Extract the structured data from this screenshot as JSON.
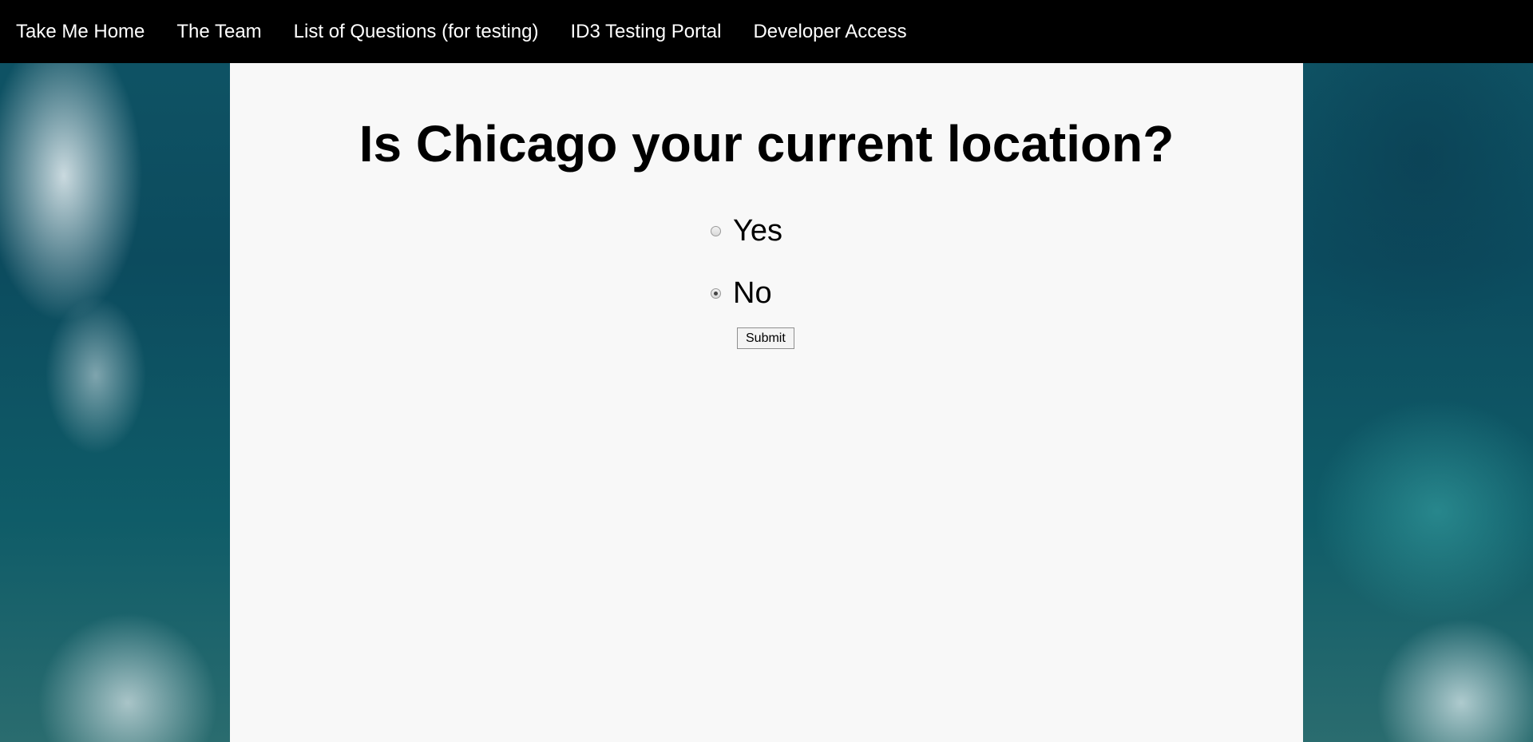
{
  "nav": {
    "items": [
      {
        "label": "Take Me Home"
      },
      {
        "label": "The Team"
      },
      {
        "label": "List of Questions (for testing)"
      },
      {
        "label": "ID3 Testing Portal"
      },
      {
        "label": "Developer Access"
      }
    ]
  },
  "main": {
    "question": "Is Chicago your current location?",
    "options": [
      {
        "label": "Yes",
        "selected": false
      },
      {
        "label": "No",
        "selected": true
      }
    ],
    "submit_label": "Submit"
  },
  "colors": {
    "navbar_bg": "#000000",
    "nav_text": "#ffffff",
    "content_bg": "#f8f8f8",
    "ocean_background": "#0f5566"
  }
}
